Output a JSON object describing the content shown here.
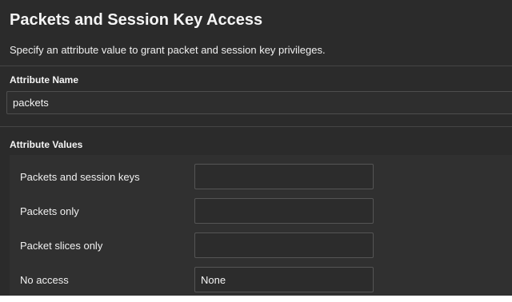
{
  "header": {
    "title": "Packets and Session Key Access",
    "description": "Specify an attribute value to grant packet and session key privileges."
  },
  "attribute_name": {
    "label": "Attribute Name",
    "value": "packets"
  },
  "attribute_values": {
    "label": "Attribute Values",
    "rows": [
      {
        "label": "Packets and session keys",
        "value": ""
      },
      {
        "label": "Packets only",
        "value": ""
      },
      {
        "label": "Packet slices only",
        "value": ""
      },
      {
        "label": "No access",
        "value": "None"
      }
    ]
  },
  "colors": {
    "panel_background": "#2b2b2b",
    "text": "#f2f2f2",
    "input_border": "#555555"
  }
}
